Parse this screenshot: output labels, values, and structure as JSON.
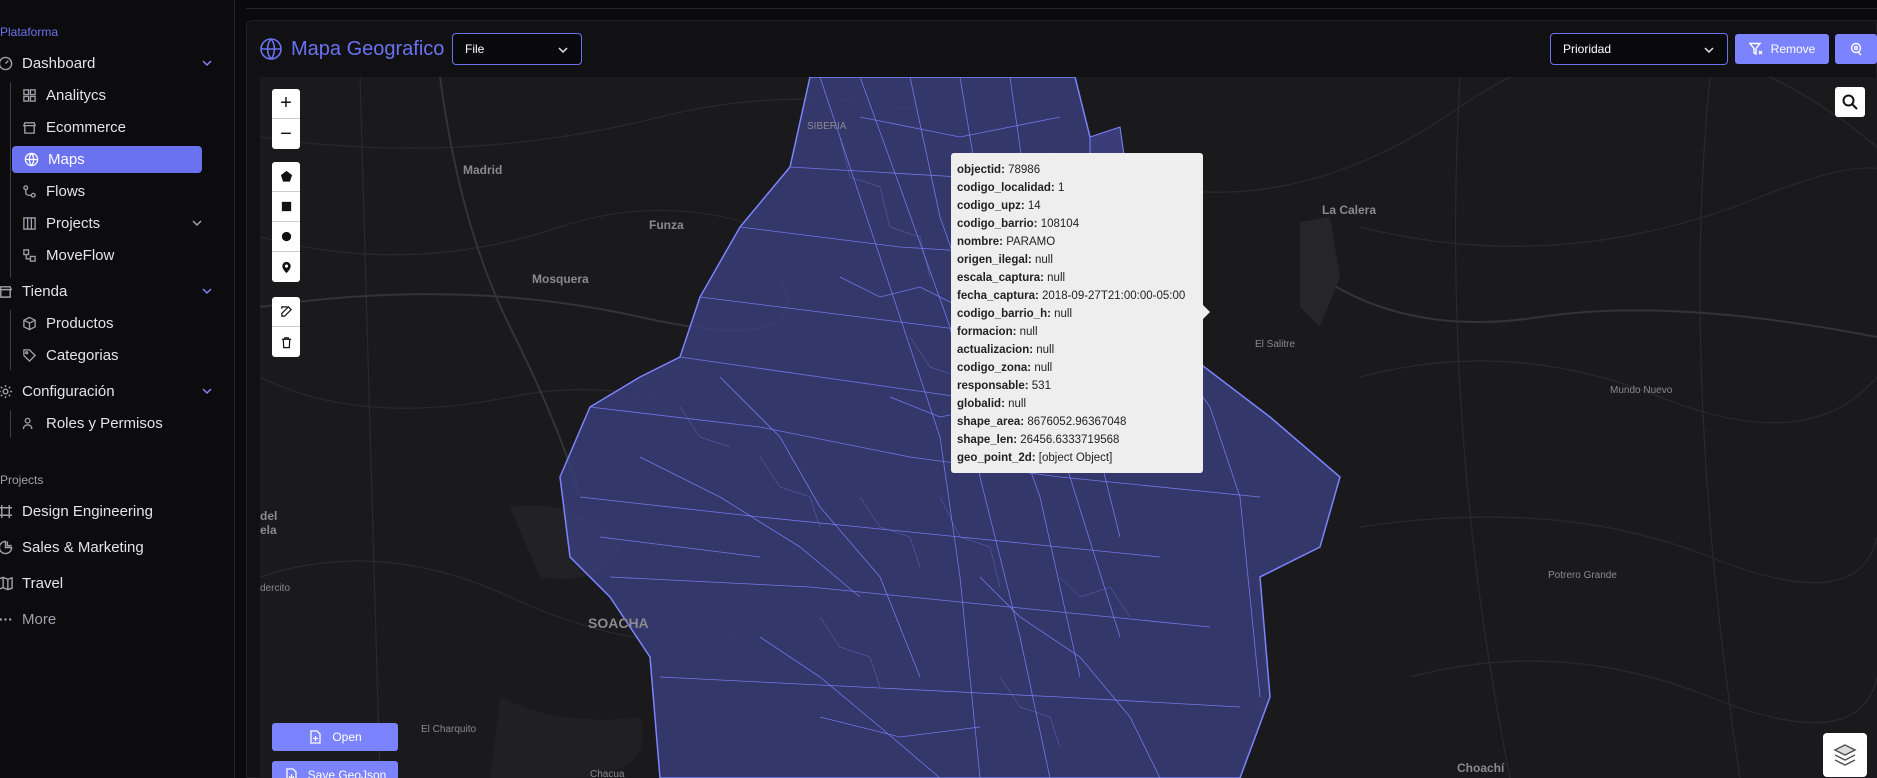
{
  "sidebar": {
    "platform_label": "Plataforma",
    "dashboard": {
      "label": "Dashboard",
      "items": [
        "Analitycs",
        "Ecommerce",
        "Maps",
        "Flows",
        "Projects",
        "MoveFlow"
      ]
    },
    "tienda": {
      "label": "Tienda",
      "items": [
        "Productos",
        "Categorias"
      ]
    },
    "config": {
      "label": "Configuración",
      "items": [
        "Roles y Permisos"
      ]
    },
    "projects_label": "Projects",
    "projects": [
      "Design Engineering",
      "Sales & Marketing",
      "Travel",
      "More"
    ]
  },
  "header": {
    "title": "Mapa Geografico",
    "file_select": "File",
    "priority_select": "Prioridad",
    "remove_label": "Remove"
  },
  "map": {
    "places": [
      "SIBERIA",
      "Madrid",
      "Funza",
      "Mosquera",
      "La Calera",
      "El Salitre",
      "Mundo Nuevo",
      "Potrero Grande",
      "SOACHA",
      "El Charquito",
      "Chacua",
      "Choachí",
      "del",
      "ela",
      "dercito"
    ],
    "controls": {
      "zoom_in": "+",
      "zoom_out": "−"
    },
    "open_label": "Open",
    "save_label": "Save GeoJson",
    "popup": [
      {
        "key": "objectid:",
        "value": " 78986"
      },
      {
        "key": "codigo_localidad:",
        "value": " 1"
      },
      {
        "key": "codigo_upz:",
        "value": " 14"
      },
      {
        "key": "codigo_barrio:",
        "value": " 108104"
      },
      {
        "key": "nombre:",
        "value": " PARAMO"
      },
      {
        "key": "origen_ilegal:",
        "value": " null"
      },
      {
        "key": "escala_captura:",
        "value": " null"
      },
      {
        "key": "fecha_captura:",
        "value": " 2018-09-27T21:00:00-05:00"
      },
      {
        "key": "codigo_barrio_h:",
        "value": " null"
      },
      {
        "key": "formacion:",
        "value": " null"
      },
      {
        "key": "actualizacion:",
        "value": " null"
      },
      {
        "key": "codigo_zona:",
        "value": " null"
      },
      {
        "key": "responsable:",
        "value": " 531"
      },
      {
        "key": "globalid:",
        "value": " null"
      },
      {
        "key": "shape_area:",
        "value": " 8676052.96367048"
      },
      {
        "key": "shape_len:",
        "value": " 26456.6333719568"
      },
      {
        "key": "geo_point_2d:",
        "value": " [object Object]"
      }
    ]
  },
  "colors": {
    "accent": "#6b72f0",
    "button": "#7c83ff",
    "region": "#3a3d78",
    "outline": "#7c83ff"
  }
}
